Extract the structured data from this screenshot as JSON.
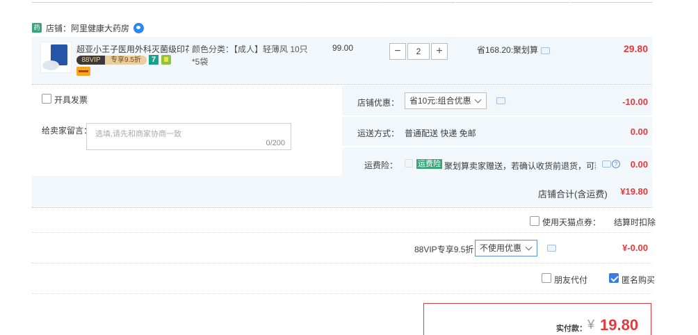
{
  "shop": {
    "logo_text": "药",
    "name": "店铺：阿里健康大药房"
  },
  "item": {
    "title": "超亚小王子医用外科灭菌级印花...",
    "vip_label": "88VIP",
    "vip_discount": "专享9.5折",
    "badge_seven": "7",
    "color_label": "颜色分类：【成人】轻薄风 10只",
    "color_value2": "*5袋",
    "unit_price": "99.00",
    "qty_minus": "−",
    "qty_value": "2",
    "qty_plus": "+",
    "save_text": "省168.20:聚划算",
    "subtotal": "29.80"
  },
  "options": {
    "invoice_label": "开具发票",
    "message_label": "给卖家留言：",
    "message_placeholder": "选填,请先和商家协商一致",
    "message_count": "0/200"
  },
  "shop_discount": {
    "label": "店铺优惠：",
    "selected": "省10元:组合优惠",
    "amount": "-10.00"
  },
  "shipping": {
    "label": "运送方式：",
    "value": "普通配送 快递 免邮",
    "amount": "0.00"
  },
  "insurance": {
    "label": "运费险：",
    "tag": "运费险",
    "desc": "聚划算卖家赠送，若确认收货前退货，可获...",
    "amount": "0.00"
  },
  "shop_total": {
    "label": "店铺合计(含运费)",
    "amount": "¥19.80"
  },
  "tmall_points": {
    "label": "使用天猫点券：",
    "value": "结算时扣除"
  },
  "vip": {
    "label": "88VIP专享9.5折",
    "selected": "不使用优惠",
    "amount": "¥-0.00"
  },
  "friend_pay": {
    "label": "朋友代付",
    "checked": false
  },
  "anonymous": {
    "label": "匿名购买",
    "checked": true
  },
  "payment": {
    "label": "实付款：",
    "currency": "¥",
    "amount": "19.80"
  },
  "colors": {
    "accent_red": "#e4393c",
    "panel_bg": "#f2f7fb",
    "link_blue": "#3b7ce4"
  }
}
